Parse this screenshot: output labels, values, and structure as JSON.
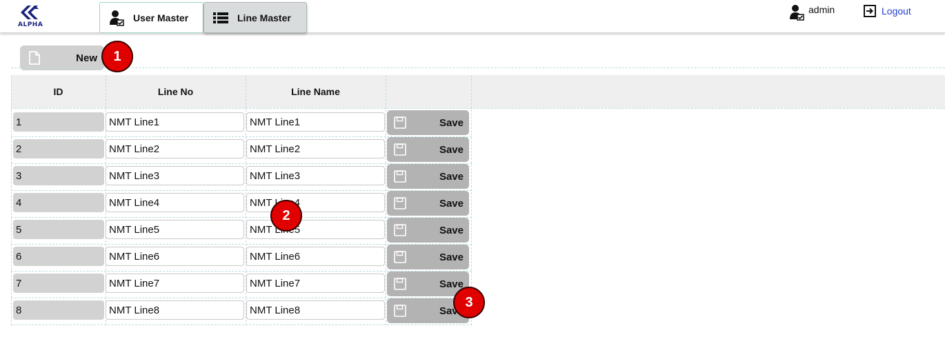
{
  "header": {
    "logo_text": "ALPHA",
    "tabs": [
      {
        "label": "User Master",
        "icon": "user-check-icon"
      },
      {
        "label": "Line Master",
        "icon": "list-icon"
      }
    ],
    "user_name": "admin",
    "logout_label": "Logout"
  },
  "toolbar": {
    "new_label": "New"
  },
  "table": {
    "columns": [
      "ID",
      "Line No",
      "Line Name",
      ""
    ],
    "save_label": "Save",
    "rows": [
      {
        "id": "1",
        "line_no": "NMT Line1",
        "line_name": "NMT Line1"
      },
      {
        "id": "2",
        "line_no": "NMT Line2",
        "line_name": "NMT Line2"
      },
      {
        "id": "3",
        "line_no": "NMT Line3",
        "line_name": "NMT Line3"
      },
      {
        "id": "4",
        "line_no": "NMT Line4",
        "line_name": "NMT Line4"
      },
      {
        "id": "5",
        "line_no": "NMT Line5",
        "line_name": "NMT Line5"
      },
      {
        "id": "6",
        "line_no": "NMT Line6",
        "line_name": "NMT Line6"
      },
      {
        "id": "7",
        "line_no": "NMT Line7",
        "line_name": "NMT Line7"
      },
      {
        "id": "8",
        "line_no": "NMT Line8",
        "line_name": "NMT Line8"
      }
    ]
  },
  "callouts": [
    "1",
    "2",
    "3"
  ],
  "colors": {
    "accent_link": "#1f3cc8",
    "callout": "#e00000",
    "save_button": "#b3b3b3",
    "logo": "#1a237e"
  }
}
